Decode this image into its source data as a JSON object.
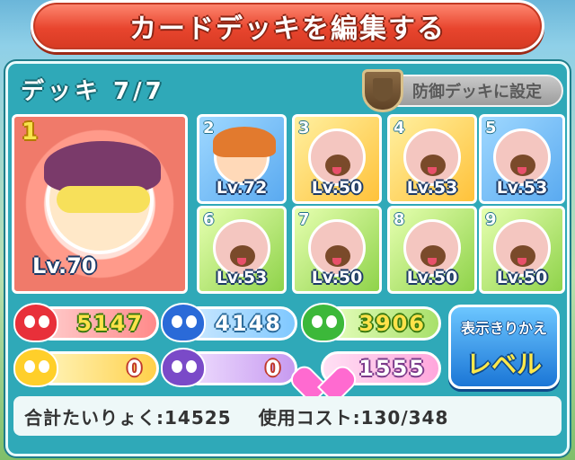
{
  "header": {
    "title": "カードデッキを編集する"
  },
  "deck": {
    "label": "デッキ 7/7",
    "defense_button_label": "防御デッキに設定"
  },
  "cards": [
    {
      "num": "1",
      "level": "Lv.70"
    },
    {
      "num": "2",
      "level": "Lv.72"
    },
    {
      "num": "3",
      "level": "Lv.50"
    },
    {
      "num": "4",
      "level": "Lv.53"
    },
    {
      "num": "5",
      "level": "Lv.53"
    },
    {
      "num": "6",
      "level": "Lv.53"
    },
    {
      "num": "7",
      "level": "Lv.50"
    },
    {
      "num": "8",
      "level": "Lv.50"
    },
    {
      "num": "9",
      "level": "Lv.50"
    }
  ],
  "stats": {
    "red": "5147",
    "blue": "4148",
    "green": "3906",
    "yellow": "0",
    "purple": "0",
    "heart": "1555"
  },
  "switch_button": {
    "top": "表示きりかえ",
    "bottom": "レベル"
  },
  "summary": {
    "total_power": "合計たいりょく:14525",
    "cost": "使用コスト:130/348"
  },
  "colors": {
    "accent": "#2fa9b8",
    "banner": "#e8452e"
  }
}
